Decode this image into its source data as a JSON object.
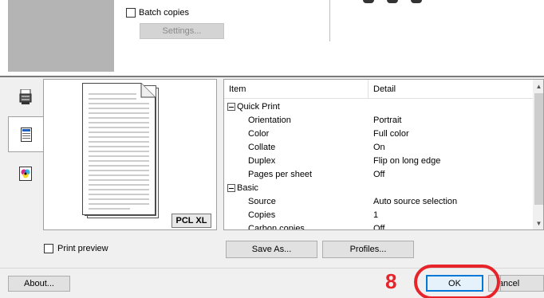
{
  "top_panel": {
    "batch_copies_label": "Batch copies",
    "settings_label": "Settings..."
  },
  "tabs": [
    {
      "name": "layout-tab-icon",
      "active": false
    },
    {
      "name": "document-tab-icon",
      "active": true
    },
    {
      "name": "color-tab-icon",
      "active": false
    }
  ],
  "preview": {
    "badge": "PCL XL",
    "print_preview_label": "Print preview"
  },
  "table": {
    "columns": [
      "Item",
      "Detail"
    ],
    "rows": [
      {
        "type": "group",
        "item": "Quick Print",
        "detail": ""
      },
      {
        "type": "child",
        "item": "Orientation",
        "detail": "Portrait"
      },
      {
        "type": "child",
        "item": "Color",
        "detail": "Full color"
      },
      {
        "type": "child",
        "item": "Collate",
        "detail": "On"
      },
      {
        "type": "child",
        "item": "Duplex",
        "detail": "Flip on long edge"
      },
      {
        "type": "child",
        "item": "Pages per sheet",
        "detail": "Off"
      },
      {
        "type": "group",
        "item": "Basic",
        "detail": ""
      },
      {
        "type": "child",
        "item": "Source",
        "detail": "Auto source selection"
      },
      {
        "type": "child",
        "item": "Copies",
        "detail": "1"
      },
      {
        "type": "child",
        "item": "Carbon copies",
        "detail": "Off"
      }
    ]
  },
  "buttons": {
    "save_as": "Save As...",
    "profiles": "Profiles...",
    "about": "About...",
    "ok": "OK",
    "cancel": "Cancel"
  },
  "annotation": {
    "step": "8",
    "color": "#e8242b"
  }
}
